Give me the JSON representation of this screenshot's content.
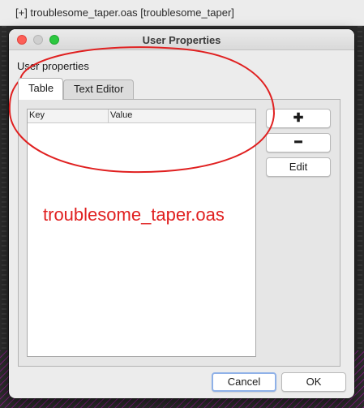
{
  "main_window": {
    "title": "[+] troublesome_taper.oas [troublesome_taper]"
  },
  "dialog": {
    "title": "User Properties",
    "group_label": "User properties",
    "tabs": [
      {
        "label": "Table",
        "active": true
      },
      {
        "label": "Text Editor",
        "active": false
      }
    ],
    "table": {
      "columns": [
        "Key",
        "Value"
      ],
      "rows": []
    },
    "side_buttons": {
      "add_glyph": "✚",
      "remove_glyph": "━",
      "edit_label": "Edit"
    },
    "footer": {
      "cancel_label": "Cancel",
      "ok_label": "OK"
    }
  },
  "annotation": {
    "text": "troublesome_taper.oas",
    "color": "#e02020"
  },
  "colors": {
    "close": "#fd5f57",
    "maximize": "#2cc840",
    "focus_ring": "#8fb1e8"
  }
}
